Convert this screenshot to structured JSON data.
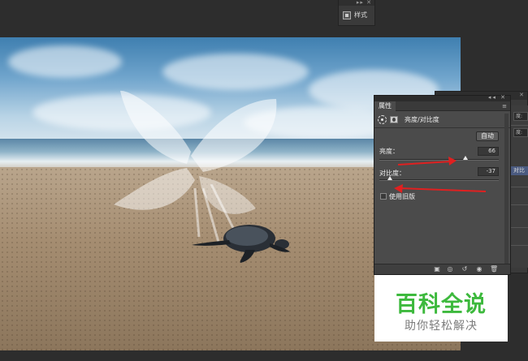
{
  "mini_panel": {
    "label": "样式",
    "controls": "▸▸ ✕"
  },
  "properties_panel": {
    "tab": "属性",
    "menu_icon": "≡",
    "window_controls": "◂◂ ✕",
    "adjustment_name": "亮度/对比度",
    "auto_label": "自动",
    "brightness": {
      "label": "亮度：",
      "value": "66",
      "min": -150,
      "max": 150,
      "level": 66
    },
    "contrast": {
      "label": "对比度：",
      "value": "-37",
      "min": -50,
      "max": 100,
      "level": -37
    },
    "legacy_label": "使用旧版",
    "legacy_checked": false,
    "icons": [
      "clip-to-layer-icon",
      "view-previous-icon",
      "reset-icon",
      "visibility-icon",
      "delete-icon"
    ]
  },
  "back_panel": {
    "fields": [
      "度:",
      "度:",
      "对比"
    ],
    "controls": "✕"
  },
  "watermark": {
    "title": "百科全说",
    "subtitle": "助你轻松解决"
  },
  "colors": {
    "arrow": "#e02020",
    "watermark_green": "#3db93d",
    "panel_bg": "#4b4b4b"
  }
}
